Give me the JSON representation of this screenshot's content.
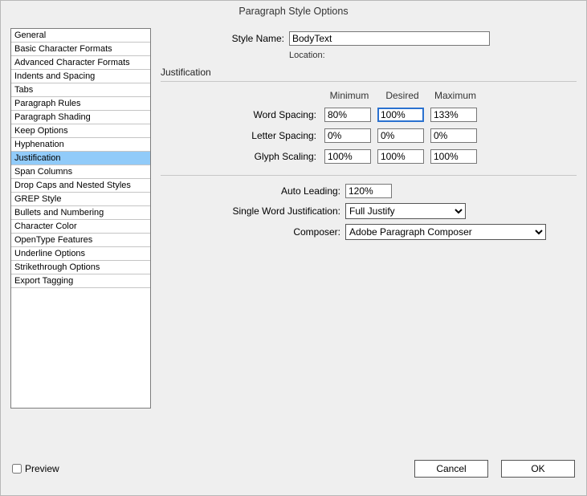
{
  "title": "Paragraph Style Options",
  "sidebar": [
    "General",
    "Basic Character Formats",
    "Advanced Character Formats",
    "Indents and Spacing",
    "Tabs",
    "Paragraph Rules",
    "Paragraph Shading",
    "Keep Options",
    "Hyphenation",
    "Justification",
    "Span Columns",
    "Drop Caps and Nested Styles",
    "GREP Style",
    "Bullets and Numbering",
    "Character Color",
    "OpenType Features",
    "Underline Options",
    "Strikethrough Options",
    "Export Tagging"
  ],
  "sidebar_selected_index": 9,
  "labels": {
    "style_name": "Style Name:",
    "location": "Location:",
    "section": "Justification",
    "minimum": "Minimum",
    "desired": "Desired",
    "maximum": "Maximum",
    "word_spacing": "Word Spacing:",
    "letter_spacing": "Letter Spacing:",
    "glyph_scaling": "Glyph Scaling:",
    "auto_leading": "Auto Leading:",
    "single_word": "Single Word Justification:",
    "composer": "Composer:",
    "preview": "Preview",
    "cancel": "Cancel",
    "ok": "OK"
  },
  "values": {
    "style_name": "BodyText",
    "word_min": "80%",
    "word_des": "100%",
    "word_max": "133%",
    "letter_min": "0%",
    "letter_des": "0%",
    "letter_max": "0%",
    "glyph_min": "100%",
    "glyph_des": "100%",
    "glyph_max": "100%",
    "auto_leading": "120%",
    "single_word": "Full Justify",
    "composer": "Adobe Paragraph Composer"
  }
}
